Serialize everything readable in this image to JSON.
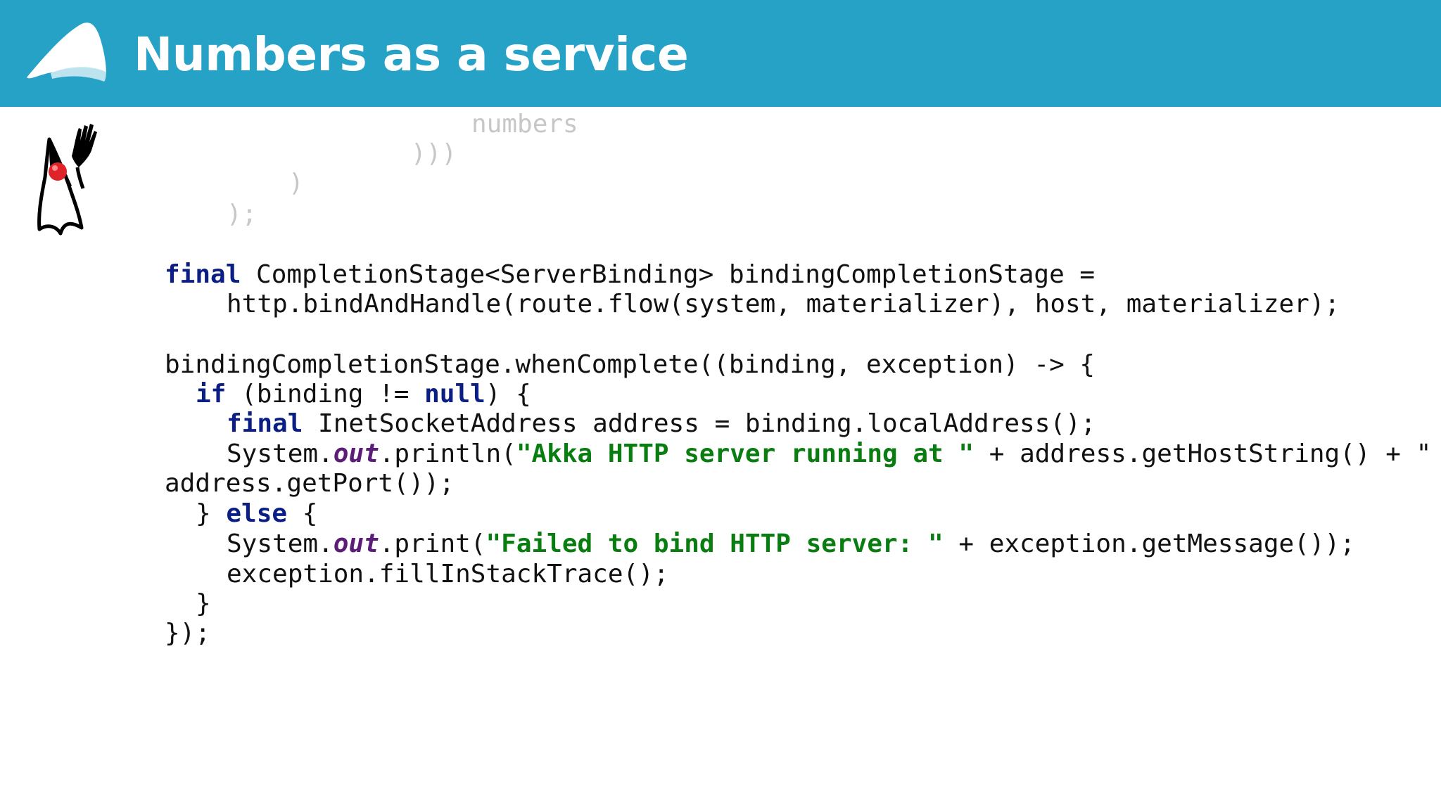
{
  "header": {
    "title": "Numbers as a service",
    "background_color": "#26a2c7",
    "logo_icon": "akka-logo-icon"
  },
  "mascot": {
    "icon": "java-duke-mascot-icon"
  },
  "code": {
    "faded_lines": [
      "numbers",
      ")))",
      ")",
      ");"
    ],
    "line1_kw": "final",
    "line1_rest": " CompletionStage<ServerBinding> bindingCompletionStage =",
    "line2": "http.bindAndHandle(route.flow(system, materializer), host, materializer);",
    "line3": "bindingCompletionStage.whenComplete((binding, exception) -> {",
    "line4_kw1": "if",
    "line4_mid": " (binding != ",
    "line4_kw2": "null",
    "line4_end": ") {",
    "line5_kw": "final",
    "line5_rest": " InetSocketAddress address = binding.localAddress();",
    "line6_a": "System.",
    "line6_out": "out",
    "line6_b": ".println(",
    "line6_str": "\"Akka HTTP server running at \"",
    "line6_c": " + address.getHostString() + \"",
    "line7": "address.getPort());",
    "line8_a": "} ",
    "line8_kw": "else",
    "line8_b": " {",
    "line9_a": "System.",
    "line9_out": "out",
    "line9_b": ".print(",
    "line9_str": "\"Failed to bind HTTP server: \"",
    "line9_c": " + exception.getMessage());",
    "line10": "exception.fillInStackTrace();",
    "line11": "}",
    "line12": "});"
  },
  "colors": {
    "keyword": "#0b1e84",
    "string": "#0a7d11",
    "static_field": "#5b1c7a",
    "faded_code": "#c7c7c7"
  }
}
